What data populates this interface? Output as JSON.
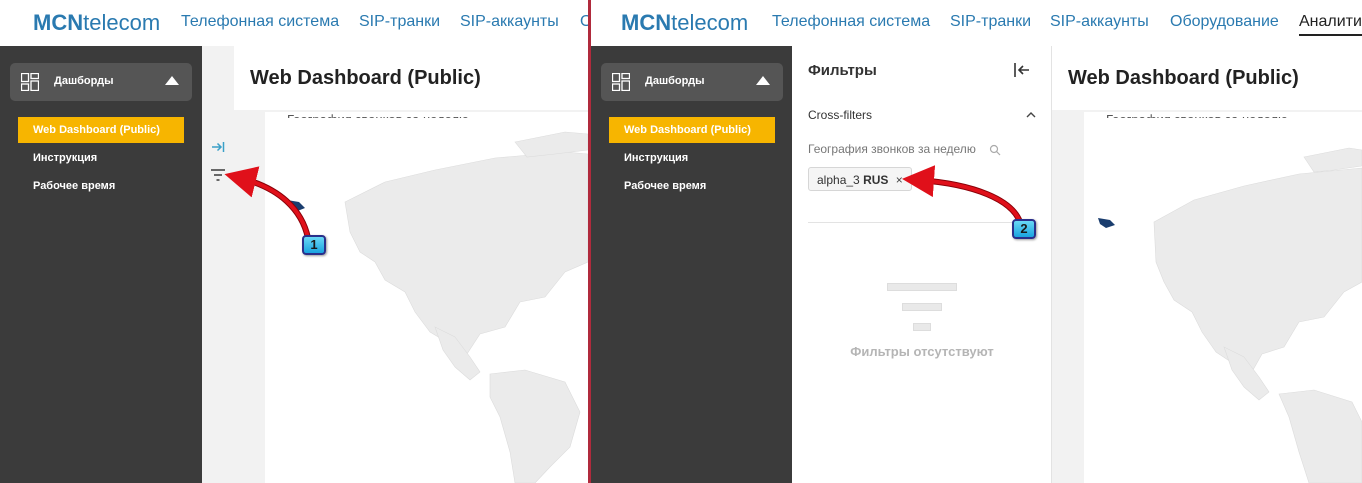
{
  "header": {
    "logo_bold": "MCN",
    "logo_rest": "telecom",
    "nav": [
      {
        "label": "Телефонная система"
      },
      {
        "label": "SIP-транки"
      },
      {
        "label": "SIP-аккаунты"
      },
      {
        "label": "Оборудование"
      },
      {
        "label": "Аналити"
      }
    ],
    "left_cut_label": "О"
  },
  "sidebar": {
    "section_title": "Дашборды",
    "items": [
      {
        "label": "Web Dashboard (Public)",
        "active": true
      },
      {
        "label": "Инструкция",
        "active": false
      },
      {
        "label": "Рабочее время",
        "active": false
      }
    ]
  },
  "dashboard": {
    "title": "Web Dashboard (Public)",
    "chart_title_partial": "География звонков за неделю"
  },
  "filters_panel": {
    "title": "Фильтры",
    "section": "Cross-filters",
    "filter_label": "География звонков за неделю",
    "chip_key": "alpha_3",
    "chip_value": "RUS",
    "chip_close": "×",
    "empty_text": "Фильтры отсутствуют"
  },
  "annotations": [
    {
      "number": "1"
    },
    {
      "number": "2"
    }
  ],
  "colors": {
    "brand_blue": "#2a7ab0",
    "sidebar_bg": "#3b3b3b",
    "active_item": "#f7b500",
    "divider": "#b02a3c",
    "arrow_red": "#e0101a",
    "map_land": "#ebebeb",
    "map_highlight": "#1a3d6e"
  }
}
